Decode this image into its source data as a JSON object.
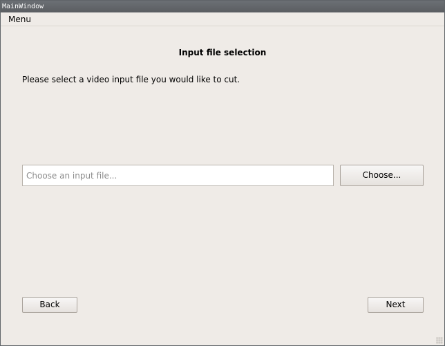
{
  "window": {
    "title": "MainWindow"
  },
  "menubar": {
    "items": [
      {
        "label": "Menu"
      }
    ]
  },
  "page": {
    "heading": "Input file selection",
    "instruction": "Please select a video input file you would like to cut.",
    "file_input": {
      "value": "",
      "placeholder": "Choose an input file..."
    },
    "choose_label": "Choose...",
    "back_label": "Back",
    "next_label": "Next"
  },
  "colors": {
    "window_background": "#efebe7",
    "titlebar_background": "#5a5d61",
    "input_background": "#ffffff",
    "button_border": "#a9a29b"
  },
  "icons": {
    "resize": "size-grip-icon"
  }
}
